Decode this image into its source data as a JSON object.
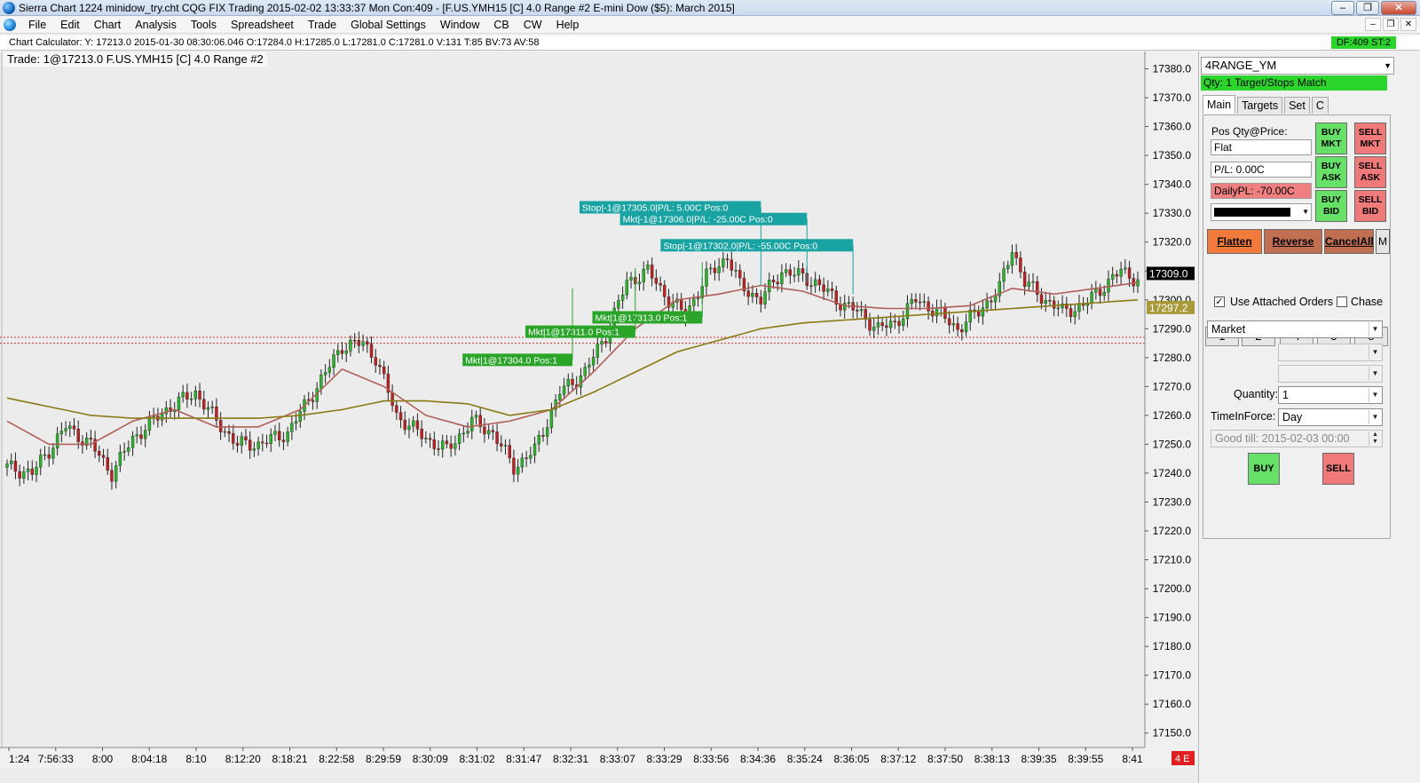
{
  "window": {
    "title": "Sierra Chart 1224 minidow_try.cht   CQG FIX Trading 2015-02-02  13:33:37 Mon   Con:409 - [F.US.YMH15 [C]  4.0 Range  #2  E-mini Dow ($5): March 2015]",
    "minimize": "–",
    "restore": "❐",
    "close": "✕"
  },
  "menu": {
    "items": [
      "File",
      "Edit",
      "Chart",
      "Analysis",
      "Tools",
      "Spreadsheet",
      "Trade",
      "Global Settings",
      "Window",
      "CB",
      "CW",
      "Help"
    ],
    "right_buttons": [
      "–",
      "❐",
      "✕"
    ]
  },
  "calc_bar": {
    "text": "Chart Calculator: Y: 17213.0   2015-01-30   08:30:06.046   O:17284.0   H:17285.0   L:17281.0   C:17281.0   V:131   T:85   BV:73   AV:58",
    "badge": "DF:409  ST:2"
  },
  "chart_header": "Trade:  1@17213.0   F.US.YMH15 [C]  4.0 Range  #2",
  "chart_data": {
    "type": "candlestick",
    "ylim": [
      17145,
      17386
    ],
    "y_ticks": [
      17380,
      17370,
      17360,
      17350,
      17340,
      17330,
      17320,
      17310,
      17300,
      17290,
      17280,
      17270,
      17260,
      17250,
      17240,
      17230,
      17220,
      17210,
      17200,
      17190,
      17180,
      17170,
      17160,
      17150
    ],
    "x_ticks": [
      "1:24",
      "7:56:33",
      "8:00",
      "8:04:18",
      "8:10",
      "8:12:20",
      "8:18:21",
      "8:22:58",
      "8:29:59",
      "8:30:09",
      "8:31:02",
      "8:31:47",
      "8:32:31",
      "8:33:07",
      "8:33:29",
      "8:33:56",
      "8:34:36",
      "8:35:24",
      "8:36:05",
      "8:37:12",
      "8:37:50",
      "8:38:13",
      "8:39:35",
      "8:39:55",
      "8:41"
    ],
    "price_path": [
      [
        0,
        17242
      ],
      [
        6,
        17240
      ],
      [
        14,
        17256
      ],
      [
        20,
        17250
      ],
      [
        25,
        17240
      ],
      [
        30,
        17252
      ],
      [
        38,
        17262
      ],
      [
        45,
        17268
      ],
      [
        50,
        17258
      ],
      [
        55,
        17250
      ],
      [
        60,
        17250
      ],
      [
        67,
        17254
      ],
      [
        74,
        17270
      ],
      [
        80,
        17284
      ],
      [
        85,
        17285
      ],
      [
        88,
        17280
      ],
      [
        93,
        17260
      ],
      [
        100,
        17252
      ],
      [
        105,
        17248
      ],
      [
        111,
        17258
      ],
      [
        116,
        17254
      ],
      [
        121,
        17242
      ],
      [
        126,
        17248
      ],
      [
        132,
        17268
      ],
      [
        138,
        17275
      ],
      [
        143,
        17288
      ],
      [
        148,
        17306
      ],
      [
        153,
        17310
      ],
      [
        158,
        17300
      ],
      [
        162,
        17295
      ],
      [
        167,
        17308
      ],
      [
        172,
        17315
      ],
      [
        175,
        17305
      ],
      [
        180,
        17300
      ],
      [
        185,
        17310
      ],
      [
        190,
        17308
      ],
      [
        193,
        17306
      ],
      [
        198,
        17300
      ],
      [
        203,
        17296
      ],
      [
        208,
        17290
      ],
      [
        212,
        17292
      ],
      [
        217,
        17300
      ],
      [
        222,
        17296
      ],
      [
        227,
        17290
      ],
      [
        232,
        17296
      ],
      [
        237,
        17304
      ],
      [
        240,
        17318
      ],
      [
        243,
        17306
      ],
      [
        248,
        17300
      ],
      [
        252,
        17296
      ],
      [
        257,
        17298
      ],
      [
        262,
        17305
      ],
      [
        266,
        17310
      ],
      [
        270,
        17307
      ]
    ],
    "ma_fast": [
      [
        0,
        17258
      ],
      [
        10,
        17250
      ],
      [
        20,
        17250
      ],
      [
        30,
        17258
      ],
      [
        40,
        17262
      ],
      [
        50,
        17256
      ],
      [
        60,
        17256
      ],
      [
        70,
        17262
      ],
      [
        80,
        17276
      ],
      [
        90,
        17270
      ],
      [
        100,
        17260
      ],
      [
        110,
        17256
      ],
      [
        120,
        17258
      ],
      [
        130,
        17262
      ],
      [
        140,
        17275
      ],
      [
        150,
        17290
      ],
      [
        160,
        17300
      ],
      [
        170,
        17302
      ],
      [
        180,
        17305
      ],
      [
        190,
        17303
      ],
      [
        200,
        17298
      ],
      [
        210,
        17297
      ],
      [
        220,
        17297
      ],
      [
        230,
        17298
      ],
      [
        240,
        17304
      ],
      [
        250,
        17302
      ],
      [
        260,
        17304
      ],
      [
        270,
        17306
      ]
    ],
    "ma_slow": [
      [
        0,
        17266
      ],
      [
        10,
        17263
      ],
      [
        20,
        17260
      ],
      [
        30,
        17259
      ],
      [
        40,
        17259
      ],
      [
        50,
        17259
      ],
      [
        60,
        17259
      ],
      [
        70,
        17260
      ],
      [
        80,
        17262
      ],
      [
        90,
        17265
      ],
      [
        100,
        17265
      ],
      [
        110,
        17264
      ],
      [
        120,
        17260
      ],
      [
        130,
        17262
      ],
      [
        140,
        17268
      ],
      [
        150,
        17275
      ],
      [
        160,
        17282
      ],
      [
        170,
        17286
      ],
      [
        180,
        17290
      ],
      [
        190,
        17292
      ],
      [
        200,
        17293
      ],
      [
        210,
        17294
      ],
      [
        220,
        17295
      ],
      [
        230,
        17296
      ],
      [
        240,
        17297
      ],
      [
        250,
        17298
      ],
      [
        260,
        17299
      ],
      [
        270,
        17300
      ]
    ],
    "ref_lines": [
      17287,
      17285
    ],
    "bar_count": 271,
    "price_labels": [
      {
        "text": "17309.0",
        "price": 17309,
        "bg": "#000000",
        "fg": "#ffffff"
      },
      {
        "text": "17297.2",
        "price": 17297.2,
        "bg": "#a89a3a",
        "fg": "#ffffff"
      }
    ],
    "order_labels": [
      {
        "text": "Stop|-1@17305.0|P/L: 5.00C Pos:0",
        "bar": 180,
        "price": 17305,
        "kind": "stop"
      },
      {
        "text": "Mkt|-1@17306.0|P/L: -25.00C Pos:0",
        "bar": 191,
        "price": 17306,
        "kind": "stop"
      },
      {
        "text": "Stop|-1@17302.0|P/L: -55.00C Pos:0",
        "bar": 202,
        "price": 17302,
        "kind": "stop"
      },
      {
        "text": "Mkt|1@17313.0 Pos:1",
        "bar": 166,
        "price": 17313,
        "kind": "buy"
      },
      {
        "text": "Mkt|1@17311.0 Pos:1",
        "bar": 150,
        "price": 17311,
        "kind": "buy"
      },
      {
        "text": "Mkt|1@17304.0 Pos:1",
        "bar": 135,
        "price": 17304,
        "kind": "buy"
      }
    ],
    "corner_badge": "4 E"
  },
  "colors": {
    "up_candle": "#2bb52b",
    "down_candle": "#c02020",
    "ma_fast": "#b06058",
    "ma_slow": "#8a7a14",
    "stop_label": "#1aa3a3",
    "buy_label": "#2aa52a",
    "ref_line": "#cc3333"
  },
  "panel": {
    "symbol_select": "4RANGE_YM",
    "qty_bar": "Qty: 1 Target/Stops Match",
    "tabs": [
      "Main",
      "Targets",
      "Set",
      "C"
    ],
    "pos_label": "Pos Qty@Price:",
    "pos_value": "Flat",
    "pl_value": "P/L: 0.00C",
    "daily_pl": "DailyPL: -70.00C",
    "buttons": {
      "buy_mkt": [
        "BUY",
        "MKT"
      ],
      "sell_mkt": [
        "SELL",
        "MKT"
      ],
      "buy_ask": [
        "BUY",
        "ASK"
      ],
      "sell_ask": [
        "SELL",
        "ASK"
      ],
      "buy_bid": [
        "BUY",
        "BID"
      ],
      "sell_bid": [
        "SELL",
        "BID"
      ]
    },
    "flatten": "Flatten",
    "reverse": "Reverse",
    "cancel_all": "CancelAll",
    "m_button": "M",
    "qty_buttons": [
      "1",
      "2",
      "4",
      "5",
      "8"
    ],
    "use_attached_orders": "Use Attached Orders",
    "chase": "Chase",
    "order_type": "Market",
    "quantity_label": "Quantity:",
    "quantity_value": "1",
    "tif_label": "TimeInForce:",
    "tif_value": "Day",
    "good_till": "Good till: 2015-02-03 00:00",
    "buy": "BUY",
    "sell": "SELL"
  }
}
